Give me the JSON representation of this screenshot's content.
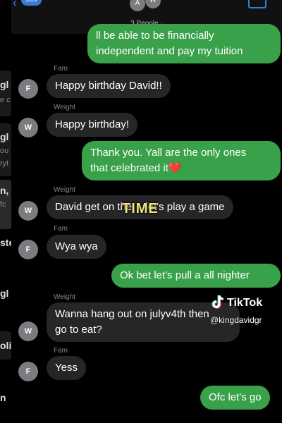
{
  "header": {
    "back_count": "189",
    "avatars": [
      "A",
      "W"
    ],
    "people_label": "3 People"
  },
  "left_strip": {
    "fragments": [
      "gl",
      "e c",
      "gl",
      "ou",
      "ryt",
      "n,",
      "fc",
      "ste",
      "gl",
      "olic",
      "n"
    ]
  },
  "messages": [
    {
      "dir": "out",
      "text": [
        "ll be able to be financially",
        "independent and pay my tuition"
      ]
    },
    {
      "dir": "in",
      "sender": "Fam",
      "avatar": "F",
      "text": [
        "Happy birthday David!!"
      ]
    },
    {
      "dir": "in",
      "sender": "Weight",
      "avatar": "W",
      "text": [
        "Happy birthday!"
      ]
    },
    {
      "dir": "out",
      "text": [
        "Thank you. Yall are the only ones",
        "that celebrated it"
      ],
      "emoji": "❤️"
    },
    {
      "dir": "in",
      "sender": "Weight",
      "avatar": "W",
      "text": [
        "David get on the… let's play a game"
      ]
    },
    {
      "dir": "in",
      "sender": "Fam",
      "avatar": "F",
      "text": [
        "Wya wya"
      ]
    },
    {
      "dir": "out",
      "text": [
        "Ok bet let's pull a all nighter"
      ]
    },
    {
      "dir": "in",
      "sender": "Weight",
      "avatar": "W",
      "text": [
        "Wanna hang out on julyv4th then",
        "go to eat?"
      ]
    },
    {
      "dir": "in",
      "sender": "Fam",
      "avatar": "F",
      "text": [
        "Yess"
      ]
    },
    {
      "dir": "out",
      "text": [
        "Ofc let's go"
      ]
    }
  ],
  "overlay": {
    "word": "TIME"
  },
  "watermark": {
    "brand": "TikTok",
    "handle": "@kingdavidgr"
  },
  "colors": {
    "outgoing": "#3aa14b",
    "incoming": "#262628",
    "accent": "#3a7bd5",
    "background": "#000000"
  }
}
